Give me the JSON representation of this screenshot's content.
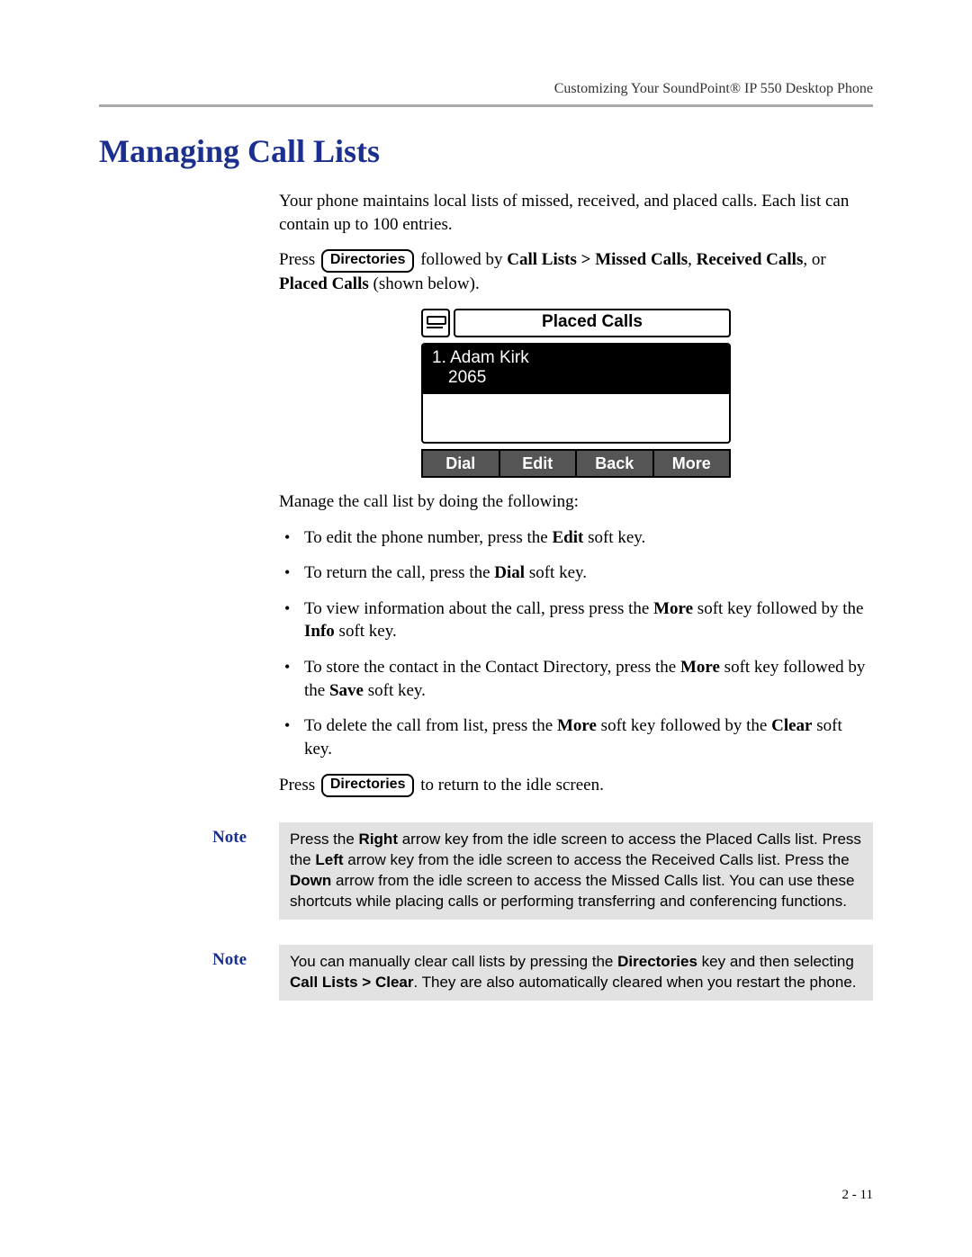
{
  "header": {
    "running": "Customizing Your SoundPoint® IP 550 Desktop Phone"
  },
  "title": "Managing Call Lists",
  "intro": "Your phone maintains local lists of missed, received, and placed calls. Each list can contain up to 100 entries.",
  "press_line": {
    "press": "Press",
    "button": "Directories",
    "followed": " followed by ",
    "path": "Call Lists > Missed Calls",
    "sep1": ", ",
    "received": "Received Calls",
    "sep2": ", or ",
    "placed": "Placed Calls",
    "tail": " (shown below)."
  },
  "screen": {
    "title": "Placed Calls",
    "entry_name": "1. Adam Kirk",
    "entry_ext": "2065",
    "softkeys": [
      "Dial",
      "Edit",
      "Back",
      "More"
    ]
  },
  "manage_lead": "Manage the call list by doing the following:",
  "bullets": [
    {
      "pre": "To edit the phone number, press the ",
      "b": "Edit",
      "post": " soft key."
    },
    {
      "pre": "To return the call, press the ",
      "b": "Dial",
      "post": " soft key."
    },
    {
      "pre": "To view information about the call, press press the ",
      "b": "More",
      "mid": " soft key followed by the ",
      "b2": "Info",
      "post": " soft key."
    },
    {
      "pre": "To store the contact in the Contact Directory, press the ",
      "b": "More",
      "mid": " soft key followed by the ",
      "b2": "Save",
      "post": " soft key."
    },
    {
      "pre": "To delete the call from list, press the ",
      "b": "More",
      "mid": " soft key followed by the ",
      "b2": "Clear",
      "post": " soft key."
    }
  ],
  "return_line": {
    "press": "Press",
    "button": "Directories",
    "tail": " to return to the idle screen."
  },
  "notes": [
    {
      "label": "Note",
      "segments": [
        {
          "t": "Press the "
        },
        {
          "b": "Right"
        },
        {
          "t": " arrow key from the idle screen to access the Placed Calls list. Press the "
        },
        {
          "b": "Left"
        },
        {
          "t": " arrow key from the idle screen to access the Received Calls list. Press the "
        },
        {
          "b": "Down"
        },
        {
          "t": " arrow from the idle screen to access the Missed Calls list. You can use these shortcuts while placing calls or performing transferring and conferencing functions."
        }
      ]
    },
    {
      "label": "Note",
      "segments": [
        {
          "t": "You can manually clear call lists by pressing the "
        },
        {
          "b": "Directories"
        },
        {
          "t": " key and then selecting "
        },
        {
          "b": "Call Lists > Clear"
        },
        {
          "t": ". They are also automatically cleared when you restart the phone."
        }
      ]
    }
  ],
  "page_number": "2 - 11"
}
